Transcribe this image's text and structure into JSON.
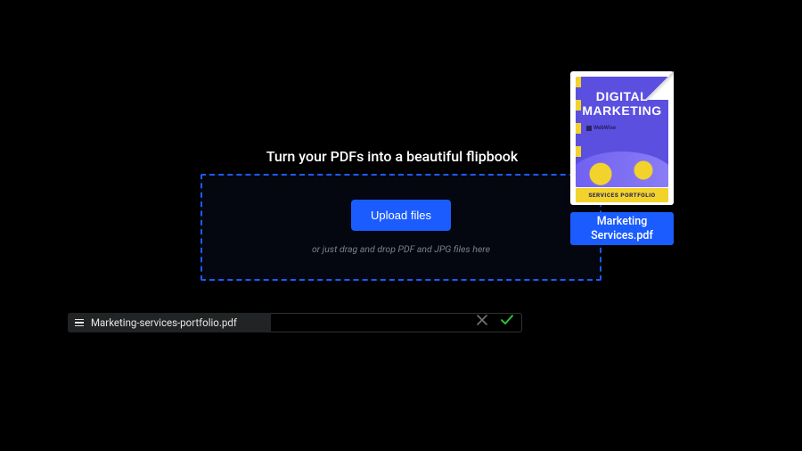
{
  "headline": "Turn your PDFs into a beautiful flipbook",
  "dropzone": {
    "button_label": "Upload files",
    "hint": "or just drag and drop PDF and JPG files here"
  },
  "dragged_file": {
    "title_line1": "DIGITAL",
    "title_line2": "MARKETING",
    "brand": "WebWise",
    "footer": "SERVICES PORTFOLIO",
    "caption": "Marketing Services.pdf"
  },
  "upload_row": {
    "file_name": "Marketing-services-portfolio.pdf",
    "target_value": ""
  },
  "colors": {
    "accent": "#1b5cff",
    "success": "#2fbf39",
    "muted": "#6f737a",
    "thumb_bg": "#5b4fe0",
    "thumb_accent": "#f2d32b"
  }
}
